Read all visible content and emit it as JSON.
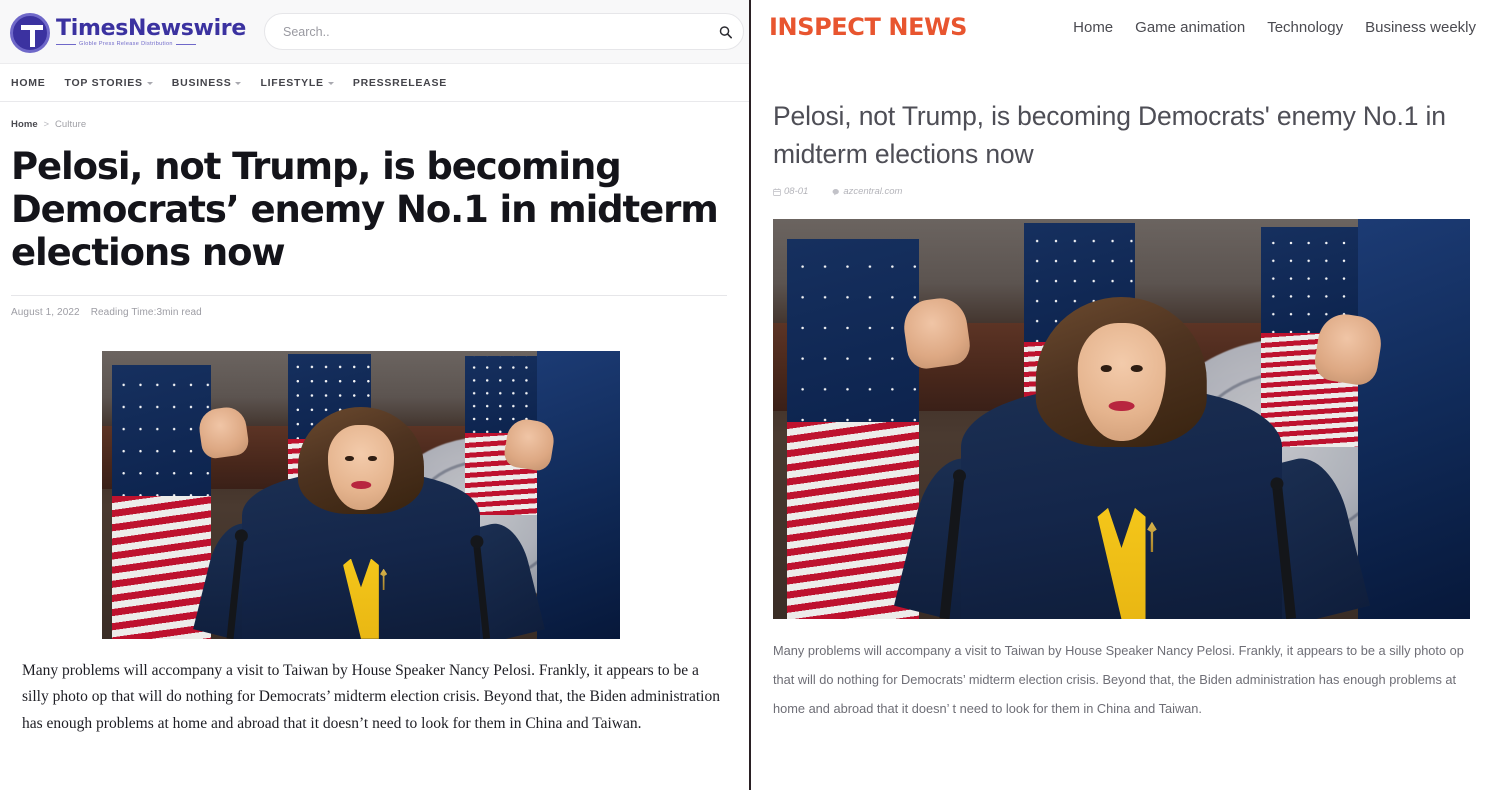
{
  "left_site": {
    "accent_color": "#3b32a0",
    "brand_name": "TimesNewswire",
    "brand_tagline": "Globle Press Release Distribution",
    "search_placeholder": "Search..",
    "search_value": "",
    "nav": [
      {
        "label": "HOME",
        "has_dropdown": false
      },
      {
        "label": "TOP STORIES",
        "has_dropdown": true
      },
      {
        "label": "BUSINESS",
        "has_dropdown": true
      },
      {
        "label": "LIFESTYLE",
        "has_dropdown": true
      },
      {
        "label": "PRESSRELEASE",
        "has_dropdown": false
      }
    ],
    "breadcrumb": {
      "home": "Home",
      "separator": ">",
      "current": "Culture"
    },
    "article": {
      "title": "Pelosi, not Trump, is becoming Democrats’ enemy No.1 in midterm elections now",
      "date": "August 1, 2022",
      "reading_time": "Reading Time:3min read",
      "body": "Many problems will accompany a visit to Taiwan by House Speaker Nancy Pelosi. Frankly, it appears to be a silly photo op that will do nothing for Democrats’ midterm election crisis. Beyond that, the Biden administration has enough problems at home and abroad that it doesn’t need to look for them in China and Taiwan."
    },
    "image_alt": "Nancy Pelosi speaking at a press conference with American flags behind her"
  },
  "right_site": {
    "accent_color": "#e8552f",
    "brand_name": "INSPECT NEWS",
    "nav": [
      {
        "label": "Home"
      },
      {
        "label": "Game animation"
      },
      {
        "label": "Technology"
      },
      {
        "label": "Business weekly"
      }
    ],
    "article": {
      "title": "Pelosi, not Trump, is becoming Democrats' enemy No.1 in midterm elections now",
      "date": "08-01",
      "source": "azcentral.com",
      "body": "Many problems will accompany a visit to Taiwan by House Speaker Nancy Pelosi. Frankly, it appears to be a silly photo op that will do nothing for Democrats’ midterm election crisis. Beyond that, the Biden administration has enough problems at home and abroad that it doesn’  t need to look for them in China and Taiwan."
    },
    "image_alt": "Nancy Pelosi speaking at a press conference with American flags behind her"
  },
  "icons": {
    "search": "search-icon",
    "calendar": "calendar-icon",
    "source_tag": "tag-icon",
    "chevron": "chevron-down-icon"
  }
}
